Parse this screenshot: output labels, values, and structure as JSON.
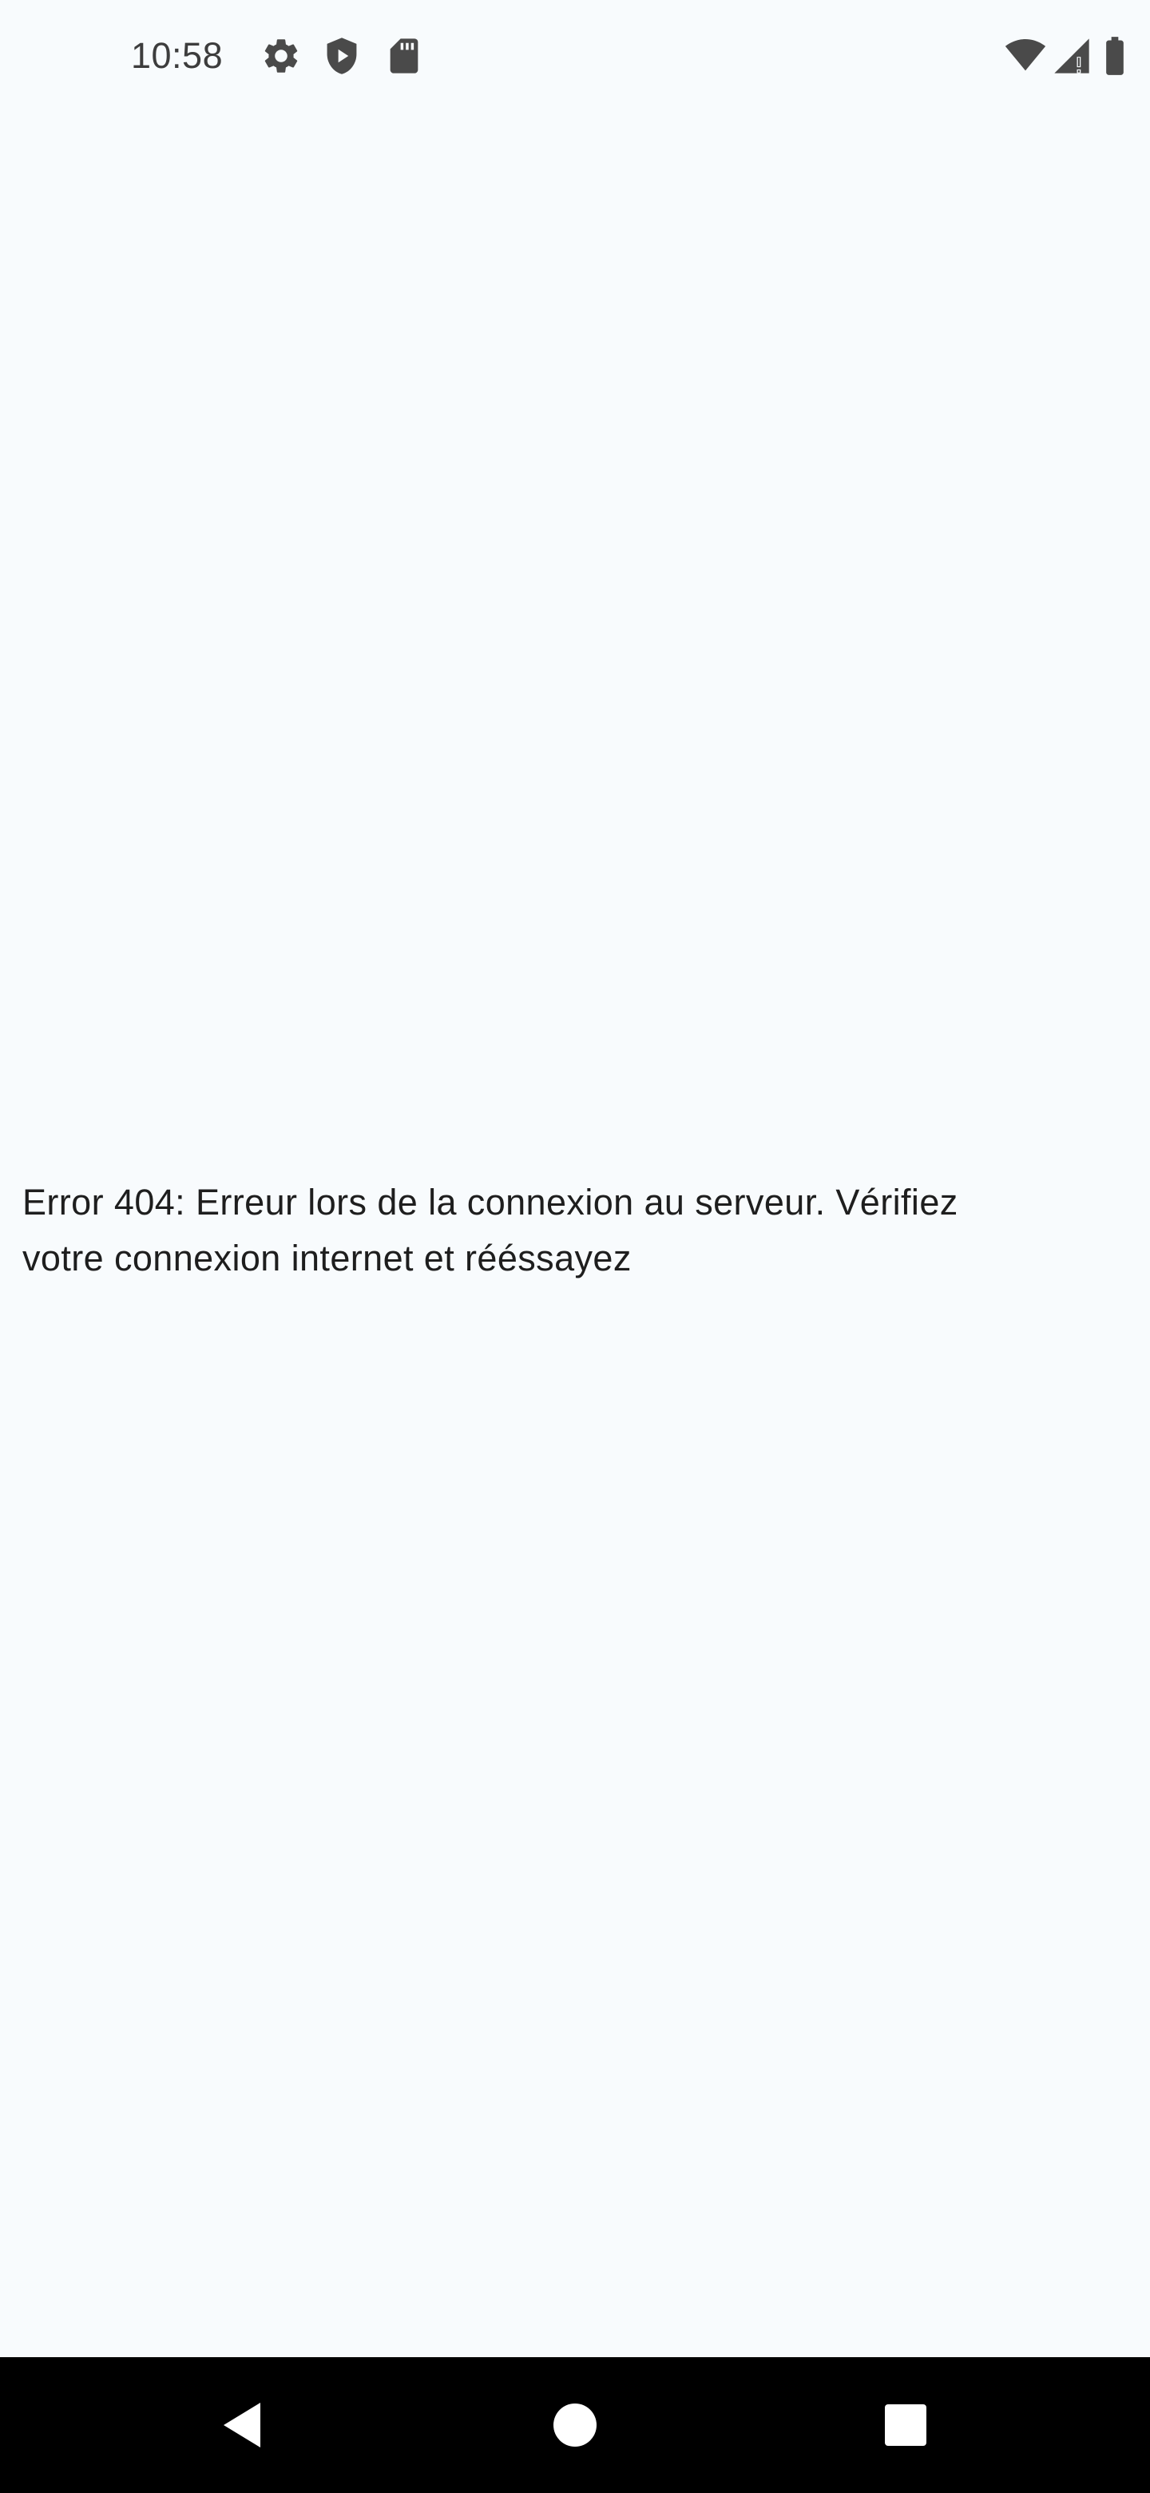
{
  "status_bar": {
    "time": "10:58",
    "left_icons": [
      "gear-icon",
      "shield-icon",
      "sd-card-icon"
    ],
    "right_icons": [
      "wifi-icon",
      "cell-signal-icon",
      "battery-icon"
    ]
  },
  "main": {
    "error_text": "Error 404: Erreur lors de la connexion au serveur. Vérifiez\nvotre connexion internet et rééssayez"
  },
  "nav_bar": {
    "buttons": [
      "back",
      "home",
      "recents"
    ]
  },
  "colors": {
    "background": "#f8fbfd",
    "nav_bar": "#000000",
    "text": "#1e1e1e",
    "status_icons": "#4a4a4a"
  }
}
